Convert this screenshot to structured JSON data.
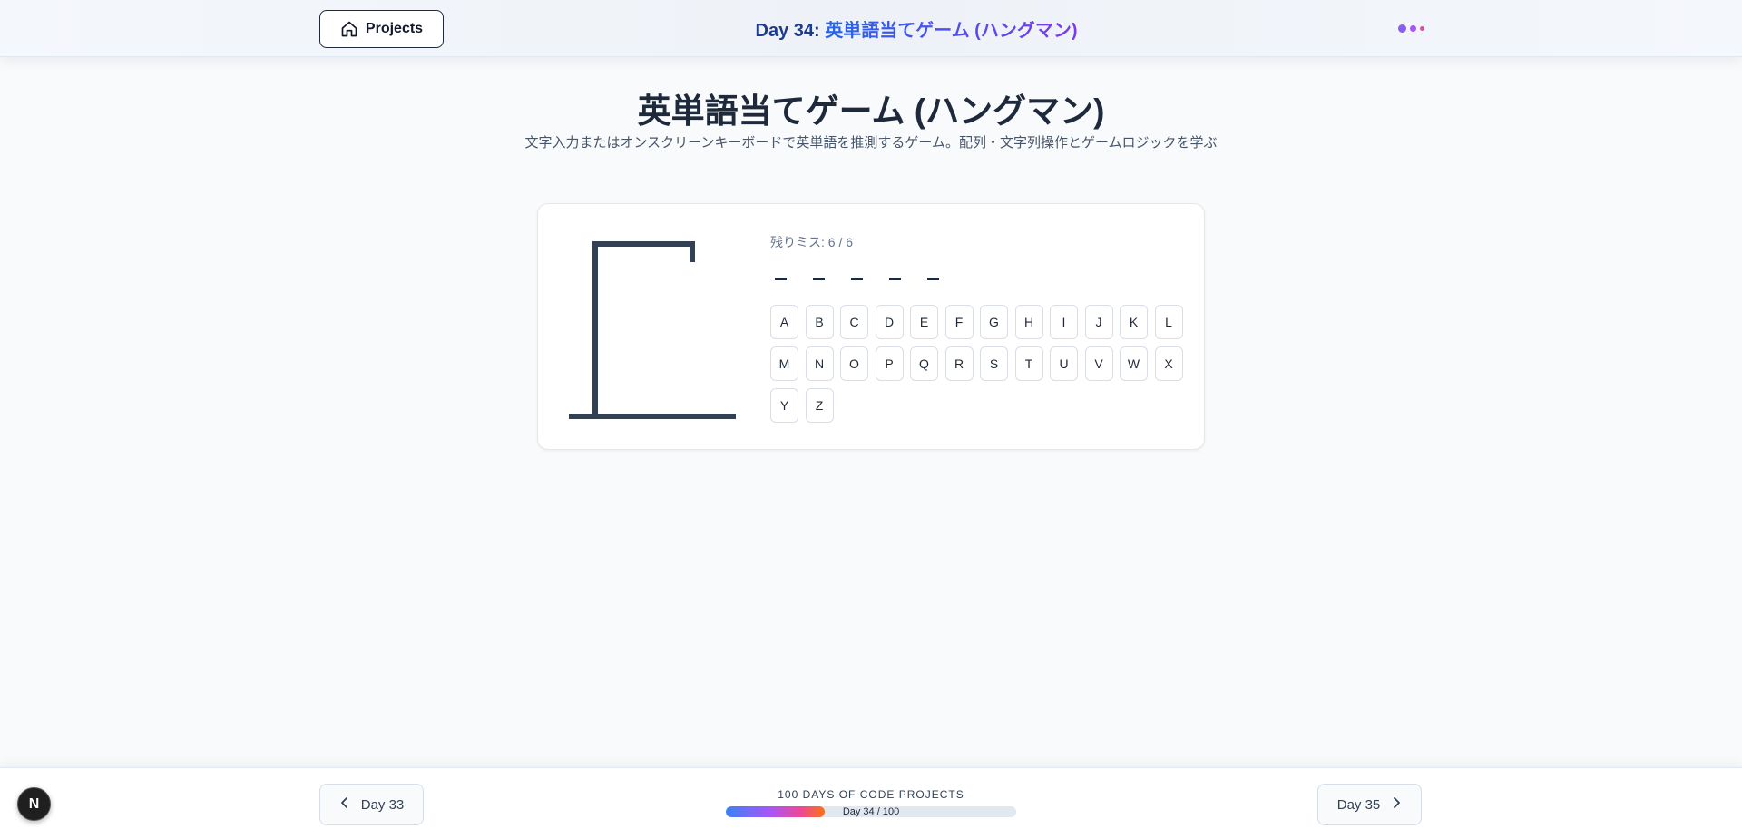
{
  "header": {
    "projects_label": "Projects",
    "title_prefix": "Day 34: ",
    "title_name": "英単語当てゲーム (ハングマン)",
    "dots_colors": [
      "#8b5cf6",
      "#a855f7",
      "#ec4899"
    ]
  },
  "page": {
    "title": "英単語当てゲーム (ハングマン)",
    "subtitle": "文字入力またはオンスクリーンキーボードで英単語を推測するゲーム。配列・文字列操作とゲームロジックを学ぶ"
  },
  "game": {
    "misses_text": "残りミス: 6 / 6",
    "word_blanks": 5,
    "keys": [
      "A",
      "B",
      "C",
      "D",
      "E",
      "F",
      "G",
      "H",
      "I",
      "J",
      "K",
      "L",
      "M",
      "N",
      "O",
      "P",
      "Q",
      "R",
      "S",
      "T",
      "U",
      "V",
      "W",
      "X",
      "Y",
      "Z"
    ]
  },
  "footer": {
    "prev_label": "Day 33",
    "next_label": "Day 35",
    "series_label": "100 DAYS OF CODE PROJECTS",
    "progress_text": "Day 34 / 100",
    "progress_fraction": 0.34
  },
  "badge": {
    "letter": "N"
  },
  "colors": {
    "accent_start": "#2563eb",
    "accent_end": "#7c3aed",
    "gallows": "#334155"
  }
}
